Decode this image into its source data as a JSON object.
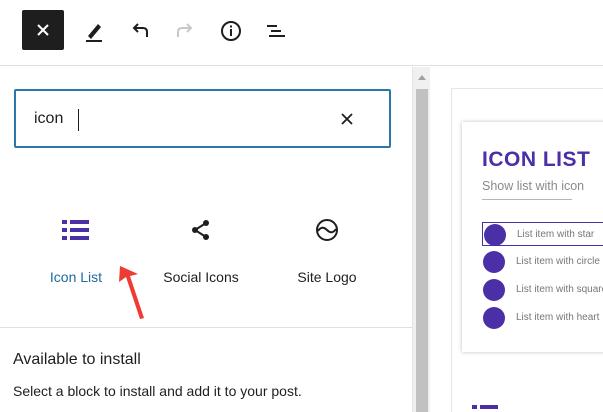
{
  "search": {
    "value": "icon"
  },
  "results": [
    {
      "label": "Icon List",
      "icon": "icon-list-icon"
    },
    {
      "label": "Social Icons",
      "icon": "share-icon"
    },
    {
      "label": "Site Logo",
      "icon": "site-logo-icon"
    }
  ],
  "install": {
    "title": "Available to install",
    "description": "Select a block to install and add it to your post."
  },
  "preview": {
    "title": "ICON LIST",
    "subtitle": "Show list with icon",
    "items": [
      "List item with star",
      "List item with circle",
      "List item with square",
      "List item with heart"
    ]
  },
  "colors": {
    "accent": "#4a2fa6",
    "focus": "#2b78a6",
    "link": "#1d6a9e",
    "arrow": "#ee3b33"
  }
}
